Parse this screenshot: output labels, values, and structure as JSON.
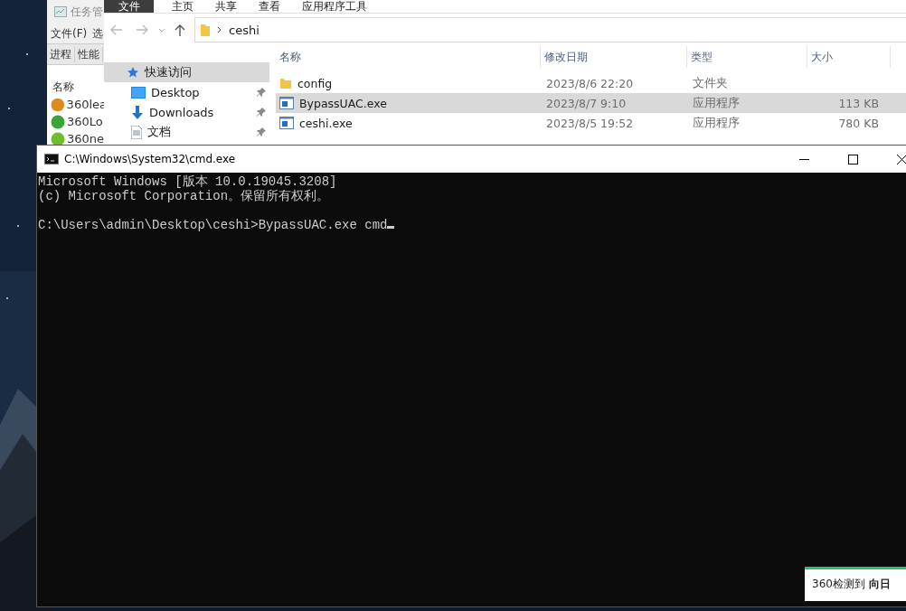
{
  "task_manager": {
    "title": "任务管",
    "menu": [
      "文件(F)",
      "选"
    ],
    "tabs": [
      "进程",
      "性能"
    ],
    "column": "名称",
    "rows": [
      {
        "name": "360lea",
        "color": "#e08a1e"
      },
      {
        "name": "360Lo",
        "color": "#3aa535"
      },
      {
        "name": "360ne",
        "color": "#6bbf2a"
      }
    ]
  },
  "explorer": {
    "file_menu": "文件",
    "ribbon_tabs": [
      "主页",
      "共享",
      "查看",
      "应用程序工具"
    ],
    "path": "ceshi",
    "nav": [
      {
        "label": "快速访问",
        "kind": "star",
        "selected": true
      },
      {
        "label": "Desktop",
        "kind": "desktop",
        "selected": false
      },
      {
        "label": "Downloads",
        "kind": "download",
        "selected": false
      },
      {
        "label": "文档",
        "kind": "document",
        "selected": false
      }
    ],
    "columns": [
      "名称",
      "修改日期",
      "类型",
      "大小"
    ],
    "files": [
      {
        "name": "config",
        "modified": "2023/8/6 22:20",
        "type": "文件夹",
        "kind": "folder",
        "selected": false
      },
      {
        "name": "BypassUAC.exe",
        "modified": "2023/8/7 9:10",
        "type": "应用程序",
        "size": "113 KB",
        "kind": "exe",
        "selected": true
      },
      {
        "name": "ceshi.exe",
        "modified": "2023/8/5 19:52",
        "type": "应用程序",
        "size": "780 KB",
        "kind": "exe",
        "selected": false
      }
    ]
  },
  "console": {
    "title": "C:\\Windows\\System32\\cmd.exe",
    "banner": [
      "Microsoft Windows [版本 10.0.19045.3208]",
      "(c) Microsoft Corporation。保留所有权利。"
    ],
    "prompt": "C:\\Users\\admin\\Desktop\\ceshi>BypassUAC.exe cmd",
    "cursor": true
  },
  "notification": {
    "text": "360检测到 **向日**"
  }
}
